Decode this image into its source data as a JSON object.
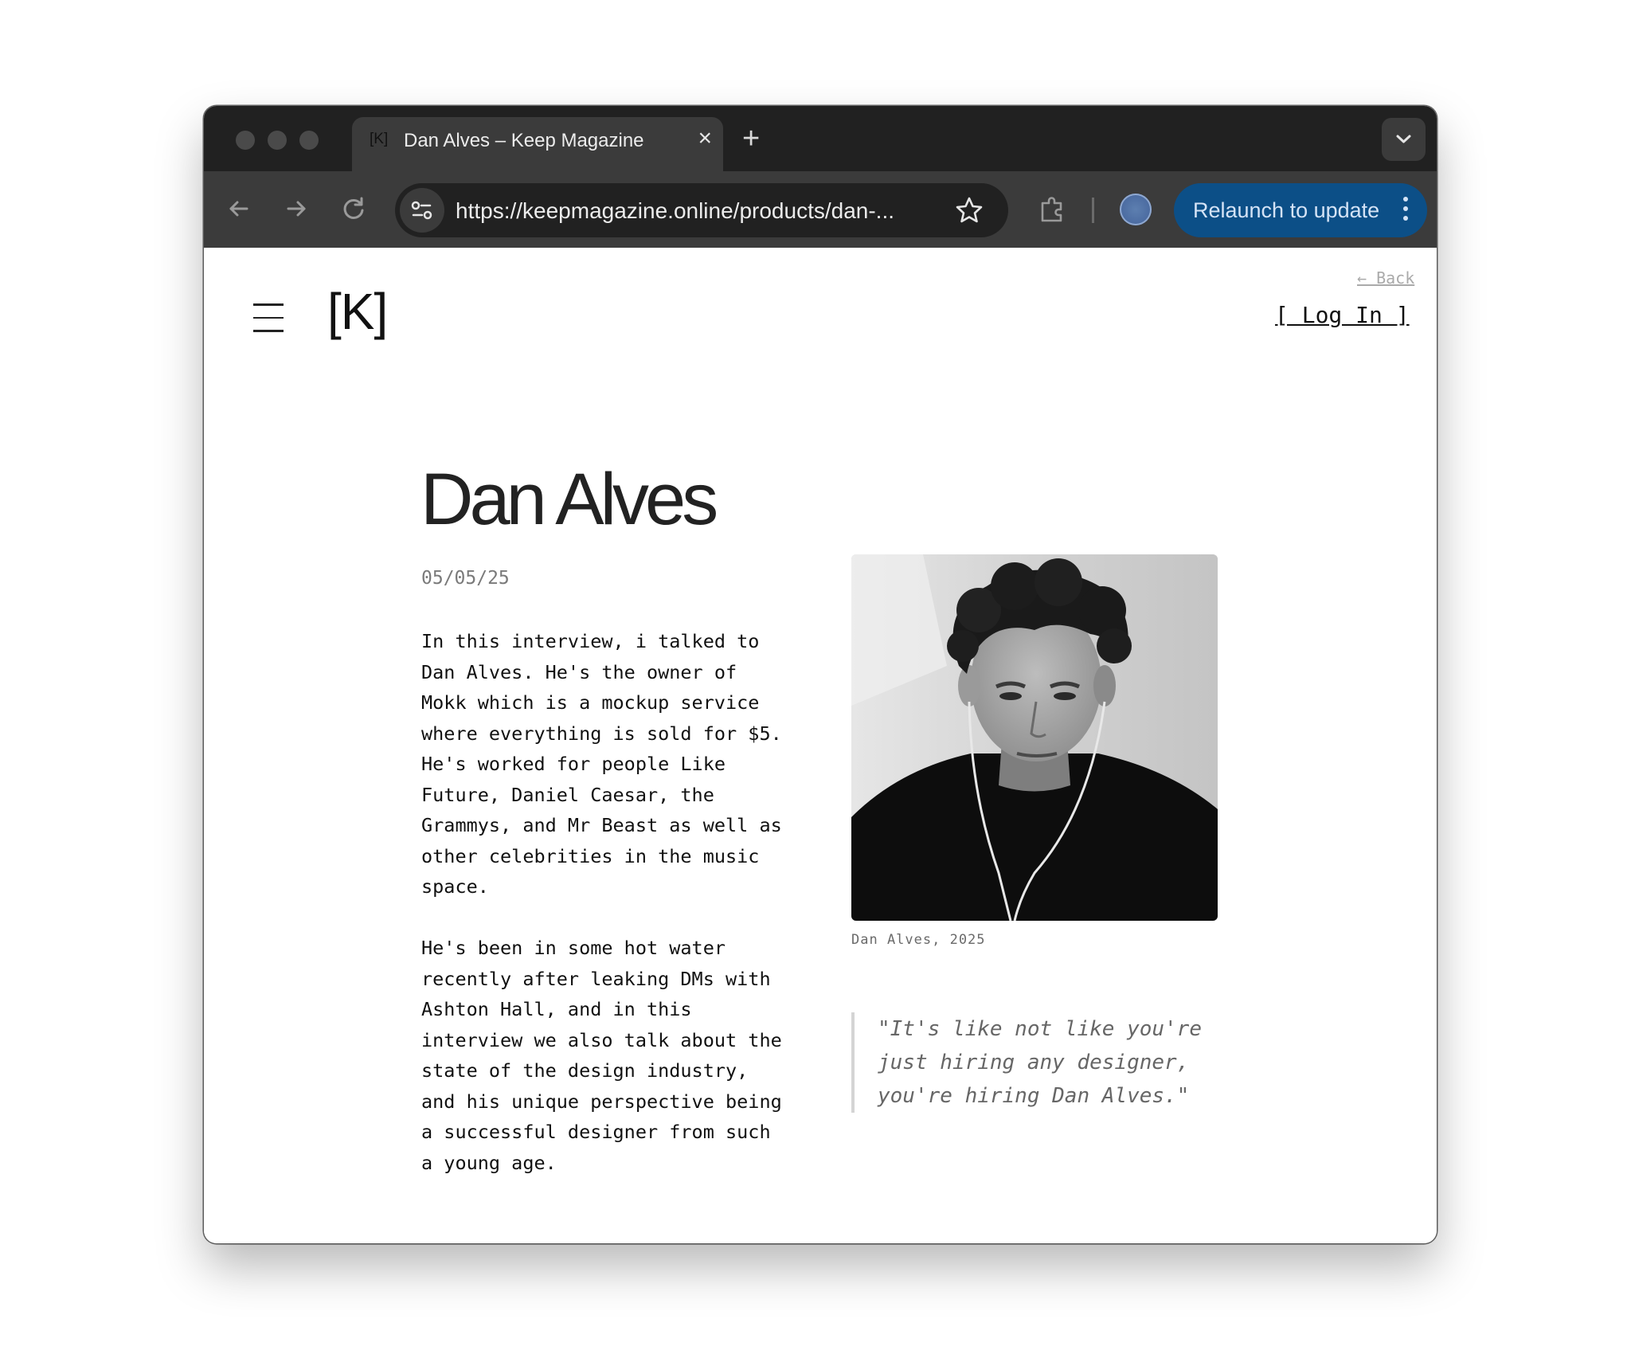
{
  "browser": {
    "tab": {
      "favicon": "[K]",
      "title": "Dan Alves – Keep Magazine",
      "close_label": "×"
    },
    "new_tab_label": "+",
    "url": "https://keepmagazine.online/products/dan-...",
    "relaunch_label": "Relaunch to update",
    "colors": {
      "titlebar": "#212121",
      "toolbar": "#3b3b3b",
      "relaunch_bg": "#0c4f87"
    },
    "icons": [
      "back-arrow-icon",
      "forward-arrow-icon",
      "reload-icon",
      "site-settings-icon",
      "bookmark-star-icon",
      "extensions-icon",
      "profile-avatar-icon",
      "kebab-menu-icon",
      "tab-search-chevron-icon"
    ]
  },
  "site": {
    "back_link": "← Back",
    "logo": "[K]",
    "login_label": "[ Log In ]",
    "menu_icon": "hamburger-icon"
  },
  "article": {
    "title": "Dan Alves",
    "date": "05/05/25",
    "paragraphs": [
      "In this interview, i talked to\nDan Alves. He's the owner of\nMokk which is a mockup service\nwhere everything is sold for $5.\nHe's worked for people Like\nFuture, Daniel Caesar, the\nGrammys, and Mr Beast as well as\nother celebrities in the music\nspace.",
      "He's been in some hot water\nrecently after leaking DMs with\nAshton Hall, and in this\ninterview we also talk about the\nstate of the design industry,\nand his unique perspective being\na successful designer from such\na young age."
    ],
    "photo_caption": "Dan Alves, 2025",
    "quote": "\"It's like not like you're just hiring any designer, you're hiring Dan Alves.\""
  }
}
